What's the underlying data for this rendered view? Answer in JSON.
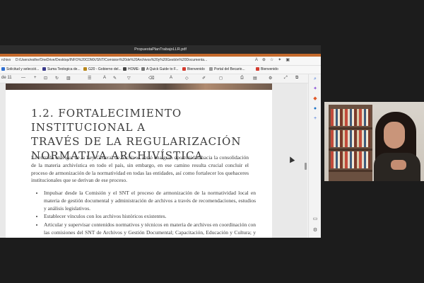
{
  "window": {
    "title": "PropuestaPlanTrabajoLLR.pdf"
  },
  "address_bar": {
    "label": "rchivo",
    "url": "D:/Users/esthe/OneDrive/Desktop/INFO%20CDMX/SNT/Comision%20de%20Archivos%20y%20Gestión%20Documenta..."
  },
  "bookmarks": [
    {
      "label": "Solicitud y selecció..."
    },
    {
      "label": "Suma Teologica de..."
    },
    {
      "label": "G20 - Gobierno del..."
    },
    {
      "label": "HOME-"
    },
    {
      "label": "A Quick Guide to F..."
    },
    {
      "label": "Bienvenido"
    },
    {
      "label": "Portal del Becario..."
    },
    {
      "label": "Bienvenido"
    }
  ],
  "pdf_toolbar": {
    "page_indicator": "de 11"
  },
  "document": {
    "heading_line1": "1.2. FORTALECIMIENTO INSTITUCIONAL A",
    "heading_line2": "TRAVÉS DE LA REGULARIZACIÓN",
    "heading_line3": "NORMATIVA ARCHIVÍSTICA",
    "intro": "La entrada en vigor de la Ley General de Archivos abrió una gran oportunidad hacia la consolidación de la materia archivística en todo el país, sin embargo, en ese camino resulta crucial concluir el proceso de armonización de la normatividad en todas las entidades, así como fortalecer los quehaceres institucionales que se derivan de ese proceso.",
    "bullets": [
      "Impulsar desde la Comisión y el SNT el proceso de armonización de la normatividad local en materia de gestión documental y administración de archivos a través de recomendaciones, estudios y análisis legislativos.",
      "Establecer vínculos con los archivos históricos existentes.",
      "Articular y supervisar contenidos normativos y técnicos en materia de archivos en coordinación con las comisiones del SNT de Archivos y Gestión Documental; Capacitación, Educación y Cultura; y el AGN, para su aprovechamiento en el SNT."
    ]
  },
  "icons": {
    "sidebar": [
      "search-icon",
      "copilot-icon",
      "office-icon",
      "outlook-icon",
      "add-icon",
      "screen-icon",
      "settings-icon"
    ]
  }
}
